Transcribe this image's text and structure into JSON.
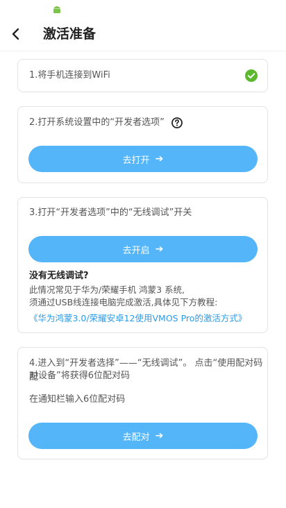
{
  "header": {
    "title": "激活准备"
  },
  "steps": [
    {
      "text": "1.将手机连接到WiFi"
    },
    {
      "text": "2.打开系统设置中的“开发者选项”",
      "button_label": "去打开"
    },
    {
      "text": "3.打开“开发者选项”中的“无线调试”开关",
      "button_label": "去开启",
      "subheading": "没有无线调试?",
      "desc_line1": "此情况常见于华为/荣耀手机 鸿蒙3 系统,",
      "desc_line2": "须通过USB线连接电脑完成激活,具体见下方教程:",
      "link_text": "《华为鸿蒙3.0/荣耀安卓12使用VMOS Pro的激活方式》"
    },
    {
      "text_line1": "4.进入到“开发者选择”——“无线调试”。 点击“使用配对码配",
      "text_line2": "对设备”将获得6位配对码",
      "text_line3": "在通知栏输入6位配对码",
      "button_label": "去配对"
    }
  ],
  "colors": {
    "button": "#54b5f8",
    "link": "#2d9be6",
    "check": "#5cb82e"
  },
  "icons": [
    "android-icon",
    "back-arrow-icon",
    "check-circle-icon",
    "help-circle-icon",
    "arrow-right-icon"
  ]
}
